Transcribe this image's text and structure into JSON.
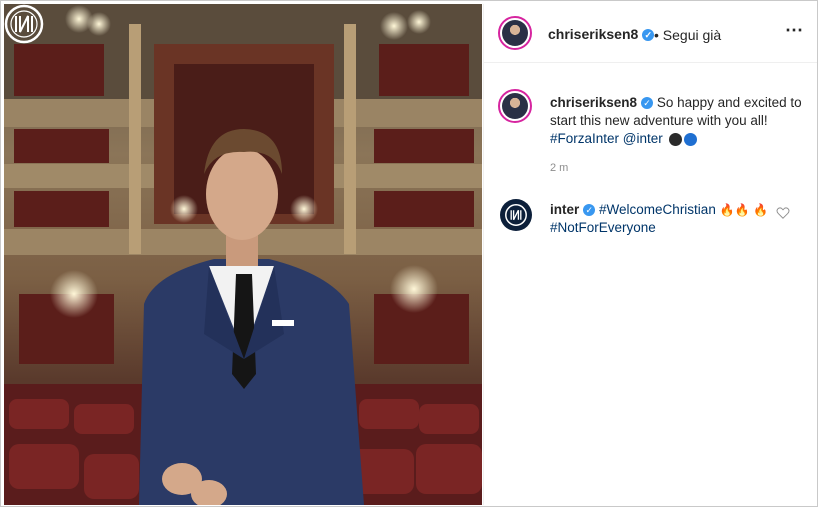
{
  "post": {
    "author": "chriseriksen8",
    "follow_text": "• Segui già",
    "more_icon": "⋯",
    "caption_author": "chriseriksen8",
    "caption_text": "So happy and excited to start this new adventure with you all!",
    "caption_hashtag": "#ForzaInter",
    "caption_mention": "@inter",
    "caption_emoji_colors": [
      "#2b2b2b",
      "#1f6fd1"
    ],
    "timestamp": "2 m"
  },
  "comment": {
    "author": "inter",
    "hashtag1": "#WelcomeChristian",
    "hashtag2": "#NotForEveryone",
    "flames": [
      "🔥",
      "🔥",
      "🔥"
    ]
  },
  "colors": {
    "verified": "#3897f0",
    "link": "#003569",
    "ring": "#d6249f"
  }
}
